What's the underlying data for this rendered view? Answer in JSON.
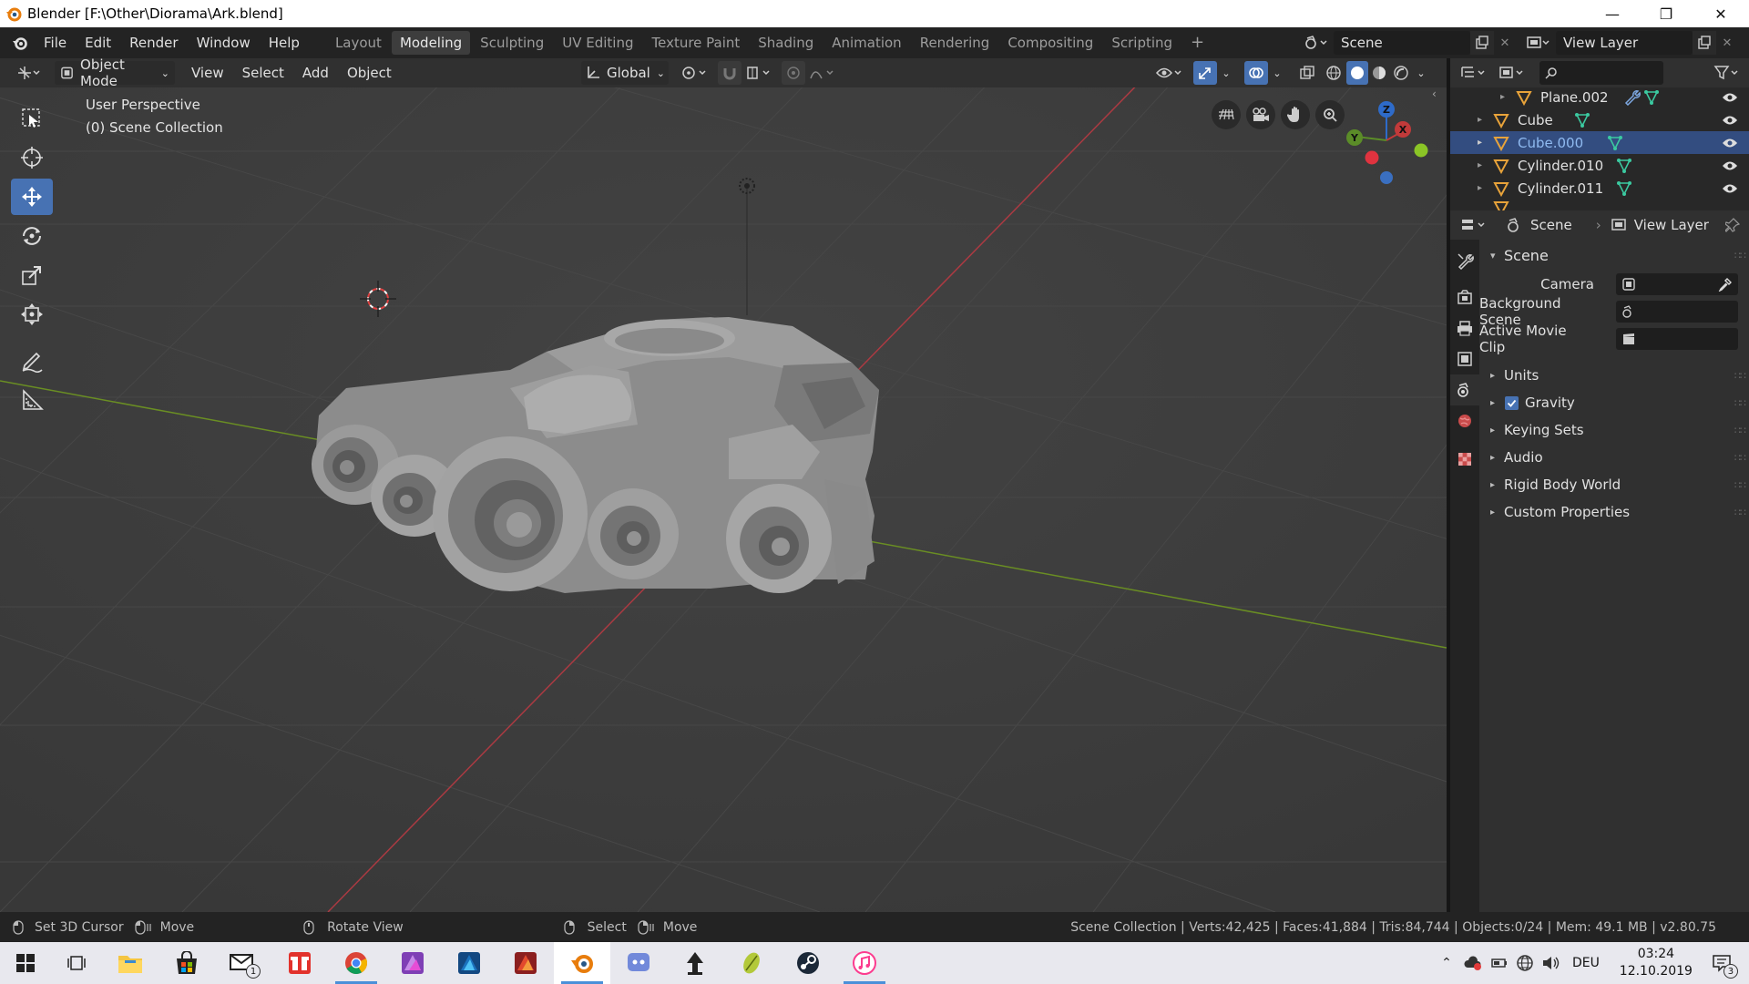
{
  "window": {
    "title": "Blender [F:\\Other\\Diorama\\Ark.blend]"
  },
  "menu": [
    "File",
    "Edit",
    "Render",
    "Window",
    "Help"
  ],
  "workspaces": [
    "Layout",
    "Modeling",
    "Sculpting",
    "UV Editing",
    "Texture Paint",
    "Shading",
    "Animation",
    "Rendering",
    "Compositing",
    "Scripting"
  ],
  "active_workspace": "Modeling",
  "scene_field": "Scene",
  "view_layer_field": "View Layer",
  "viewport_header": {
    "mode": "Object Mode",
    "menus": [
      "View",
      "Select",
      "Add",
      "Object"
    ],
    "transform_orientation": "Global"
  },
  "viewport": {
    "perspective_label": "User Perspective",
    "collection_label": "(0) Scene Collection",
    "gizmo_axes": [
      "Z",
      "Y",
      "X"
    ]
  },
  "outliner": {
    "items": [
      {
        "name": "Plane.002",
        "selected": false
      },
      {
        "name": "Cube",
        "selected": false
      },
      {
        "name": "Cube.000",
        "selected": true
      },
      {
        "name": "Cylinder.010",
        "selected": false
      },
      {
        "name": "Cylinder.011",
        "selected": false
      }
    ]
  },
  "properties": {
    "header_scene": "Scene",
    "header_view_layer": "View Layer",
    "section_title": "Scene",
    "fields": [
      {
        "label": "Camera"
      },
      {
        "label": "Background Scene"
      },
      {
        "label": "Active Movie Clip"
      }
    ],
    "subpanels": [
      "Units",
      "Gravity",
      "Keying Sets",
      "Audio",
      "Rigid Body World",
      "Custom Properties"
    ],
    "gravity_checked": true
  },
  "statusbar": {
    "left": [
      "Set 3D Cursor",
      "Move",
      "Rotate View",
      "Select",
      "Move"
    ],
    "stats": "Scene Collection | Verts:42,425 | Faces:41,884 | Tris:84,744 | Objects:0/24 | Mem: 49.1 MB | v2.80.75"
  },
  "taskbar": {
    "language": "DEU",
    "time": "03:24",
    "date": "12.10.2019",
    "mail_badge": "1",
    "notification_count": "3"
  },
  "colors": {
    "accent": "#4772b3",
    "viewport_bg": "#3d3d3d",
    "x_axis": "#ab3a42",
    "y_axis": "#6a8e23",
    "mesh_icon": "#e8a33a",
    "data_icon": "#3bc9a0"
  }
}
